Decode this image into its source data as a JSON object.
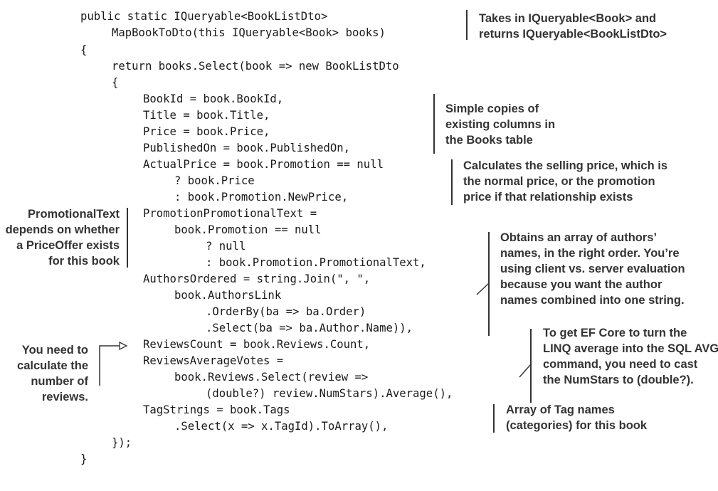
{
  "code": {
    "lines": [
      "public static IQueryable<BookListDto>",
      "MapBookToDto(this IQueryable<Book> books)",
      "{",
      "return books.Select(book => new BookListDto",
      "{",
      "BookId = book.BookId,",
      "Title = book.Title,",
      "Price = book.Price,",
      "PublishedOn = book.PublishedOn,",
      "ActualPrice = book.Promotion == null",
      "? book.Price",
      ": book.Promotion.NewPrice,",
      "PromotionPromotionalText =",
      "book.Promotion == null",
      "? null",
      ": book.Promotion.PromotionalText,",
      "AuthorsOrdered = string.Join(\", \",",
      "book.AuthorsLink",
      ".OrderBy(ba => ba.Order)",
      ".Select(ba => ba.Author.Name)),",
      "ReviewsCount = book.Reviews.Count,",
      "ReviewsAverageVotes =",
      "book.Reviews.Select(review =>",
      "(double?) review.NumStars).Average(),",
      "TagStrings = book.Tags",
      ".Select(x => x.TagId).ToArray(),",
      "});",
      "}"
    ]
  },
  "annotations": {
    "mapping": [
      "Takes in IQueryable<Book> and",
      "returns IQueryable<BookListDto>"
    ],
    "simple_copies": [
      "Simple copies of",
      "existing columns in",
      "the Books table"
    ],
    "actual_price": [
      "Calculates the selling price, which is",
      "the normal price, or the promotion",
      "price if that relationship exists"
    ],
    "promo_text": [
      "PromotionalText",
      "depends on whether",
      "a PriceOffer exists",
      "for this book"
    ],
    "authors": [
      "Obtains an array of authors’",
      "names, in the right order. You’re",
      "using client vs. server evaluation",
      "because you want the author",
      "names combined into one string."
    ],
    "avg": [
      "To get EF Core to turn the",
      "LINQ average into the SQL AVG",
      "command, you need to cast",
      "the NumStars to (double?)."
    ],
    "reviews_count": [
      "You need to",
      "calculate the",
      "number of",
      "reviews."
    ],
    "tags": [
      "Array of Tag names",
      "(categories) for this book"
    ]
  }
}
